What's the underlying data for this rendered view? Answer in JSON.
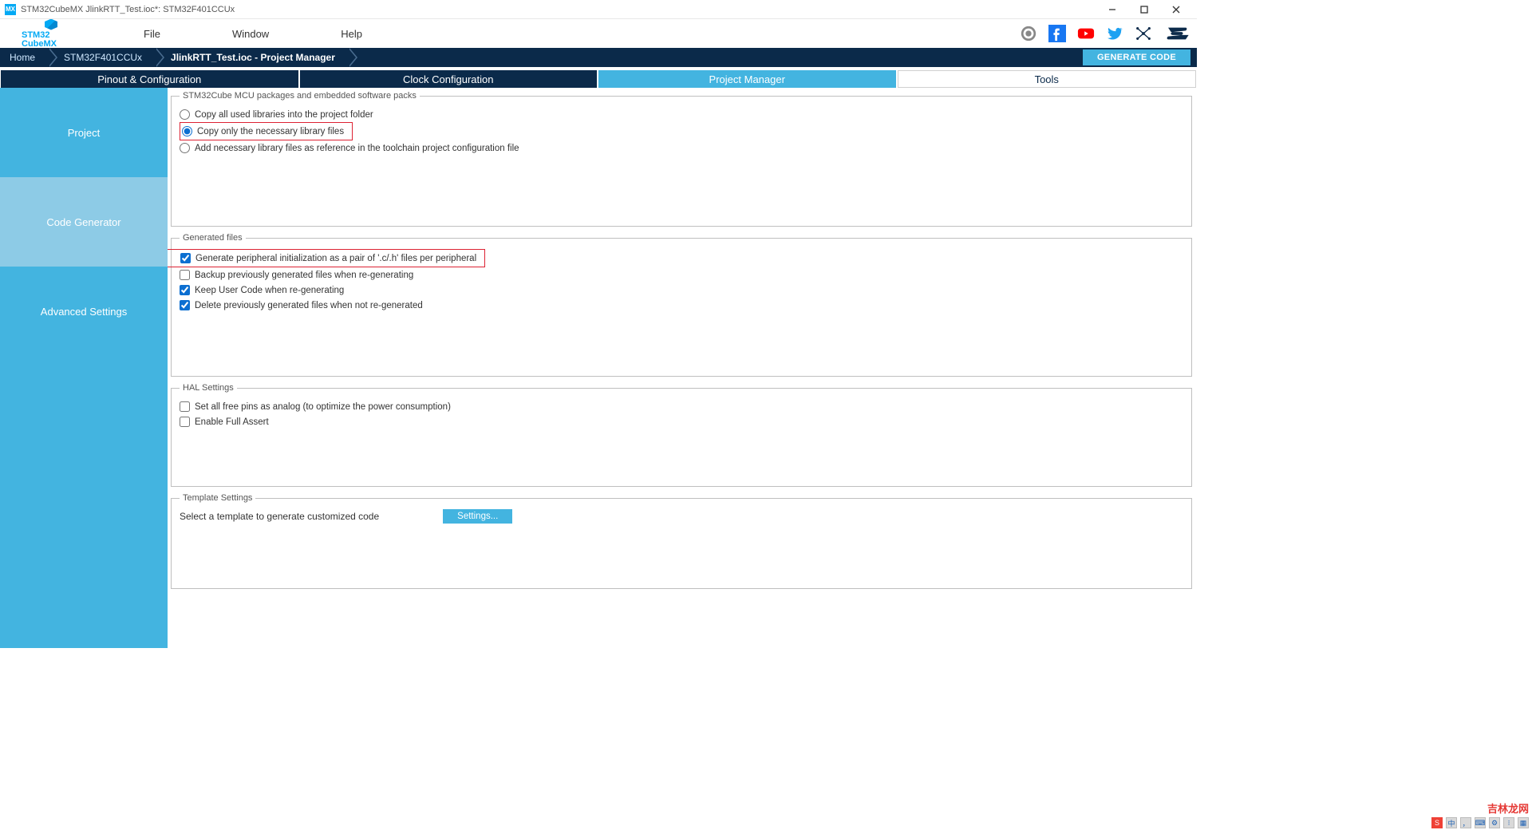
{
  "window": {
    "title": "STM32CubeMX JlinkRTT_Test.ioc*: STM32F401CCUx",
    "app_icon_text": "MX"
  },
  "logo": {
    "line1": "STM32",
    "line2": "CubeMX"
  },
  "menu": {
    "file": "File",
    "window": "Window",
    "help": "Help"
  },
  "breadcrumb": {
    "home": "Home",
    "chip": "STM32F401CCUx",
    "page": "JlinkRTT_Test.ioc - Project Manager"
  },
  "generate_button": "GENERATE CODE",
  "tabs": {
    "pinout": "Pinout & Configuration",
    "clock": "Clock Configuration",
    "project": "Project Manager",
    "tools": "Tools"
  },
  "sidebar": {
    "project": "Project",
    "codegen": "Code Generator",
    "advanced": "Advanced Settings"
  },
  "packs": {
    "legend": "STM32Cube MCU packages and embedded software packs",
    "opt_all": "Copy all used libraries into the project folder",
    "opt_necessary": "Copy only the necessary library files",
    "opt_reference": "Add necessary library files as reference in the toolchain project configuration file"
  },
  "genfiles": {
    "legend": "Generated files",
    "pair": "Generate peripheral initialization as a pair of '.c/.h' files per peripheral",
    "backup": "Backup previously generated files when re-generating",
    "keep": "Keep User Code when re-generating",
    "delete": "Delete previously generated files when not re-generated"
  },
  "hal": {
    "legend": "HAL Settings",
    "analog": "Set all free pins as analog (to optimize the power consumption)",
    "assert": "Enable Full Assert"
  },
  "template": {
    "legend": "Template Settings",
    "prompt": "Select a template to generate customized code",
    "button": "Settings..."
  },
  "watermark": "吉林龙网"
}
